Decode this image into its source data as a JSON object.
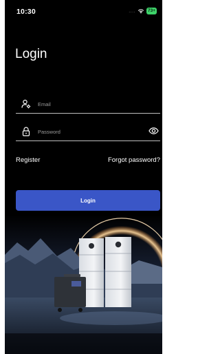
{
  "status_bar": {
    "time": "10:30",
    "signal": "....",
    "battery": "73+"
  },
  "login": {
    "title": "Login",
    "email_placeholder": "Email",
    "password_placeholder": "Password",
    "register_label": "Register",
    "forgot_label": "Forgot password?",
    "submit_label": "Login"
  },
  "icons": {
    "user": "user-settings-icon",
    "lock": "lock-icon",
    "eye": "eye-icon",
    "wifi": "wifi-icon"
  },
  "colors": {
    "background": "#000000",
    "primary_button": "#3a56c7",
    "text": "#ffffff",
    "placeholder": "#9c9c9c",
    "divider": "#bfbfbf",
    "battery": "#3ed36a"
  }
}
